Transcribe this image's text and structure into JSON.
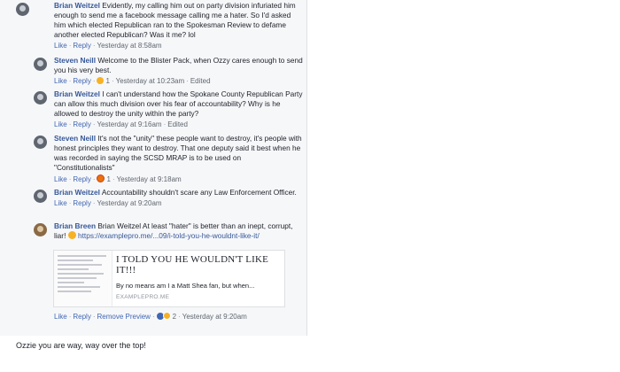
{
  "comments": [
    {
      "author": "Brian Weitzel",
      "text": "Evidently, my calling him out on party division infuriated him enough to send me a facebook message calling me a hater. So I'd asked him which elected Republican ran to the Spokesman Review to defame another elected Republican? Was it me? lol",
      "actions": {
        "like": "Like",
        "reply": "Reply"
      },
      "time": "Yesterday at 8:58am"
    },
    {
      "author": "Steven Neill",
      "text": "Welcome to the Blister Pack, when Ozzy cares enough to send you his very best.",
      "actions": {
        "like": "Like",
        "reply": "Reply"
      },
      "reaction_count": "1",
      "time": "Yesterday at 10:23am",
      "edited": "Edited"
    },
    {
      "author": "Brian Weitzel",
      "text": "I can't understand how the Spokane County Republican Party can allow this much division over his fear of accountability? Why is he allowed to destroy the unity within the party?",
      "actions": {
        "like": "Like",
        "reply": "Reply"
      },
      "time": "Yesterday at 9:16am",
      "edited": "Edited"
    },
    {
      "author": "Steven Neill",
      "text": "It's not the \"unity\" these people want to destroy, it's people with honest principles they want to destroy. That one deputy said it best when he was recorded in saying the SCSD MRAP is to be used on \"Constitutionalists\"",
      "actions": {
        "like": "Like",
        "reply": "Reply"
      },
      "reaction_count": "1",
      "time": "Yesterday at 9:18am"
    },
    {
      "author": "Brian Weitzel",
      "text": "Accountability shouldn't scare any Law Enforcement Officer.",
      "actions": {
        "like": "Like",
        "reply": "Reply"
      },
      "time": "Yesterday at 9:20am"
    },
    {
      "author": "Brian Breen",
      "text_before": "Brian Weitzel At least \"hater\" is better than an inept, corrupt, liar!",
      "link": "https://examplepro.me/...09/i-told-you-he-wouldnt-like-it/",
      "preview": {
        "title": "I TOLD YOU HE WOULDN'T LIKE IT!!!",
        "description": "By no means am I a Matt Shea fan, but when...",
        "domain": "EXAMPLEPRO.ME"
      },
      "actions": {
        "like": "Like",
        "reply": "Reply",
        "remove_preview": "Remove Preview"
      },
      "reaction_count": "2",
      "time": "Yesterday at 9:20am"
    }
  ],
  "caption": "Ozzie you are way, way over the top!",
  "icons": {
    "haha": "haha-reaction-icon",
    "angry": "angry-reaction-icon",
    "like": "like-reaction-icon",
    "wow": "wow-reaction-icon",
    "smile": "smile-emoji-icon"
  },
  "colors": {
    "author": "#365899",
    "action": "#4267b2",
    "meta": "#606770",
    "panel_bg": "#f6f7f9"
  }
}
